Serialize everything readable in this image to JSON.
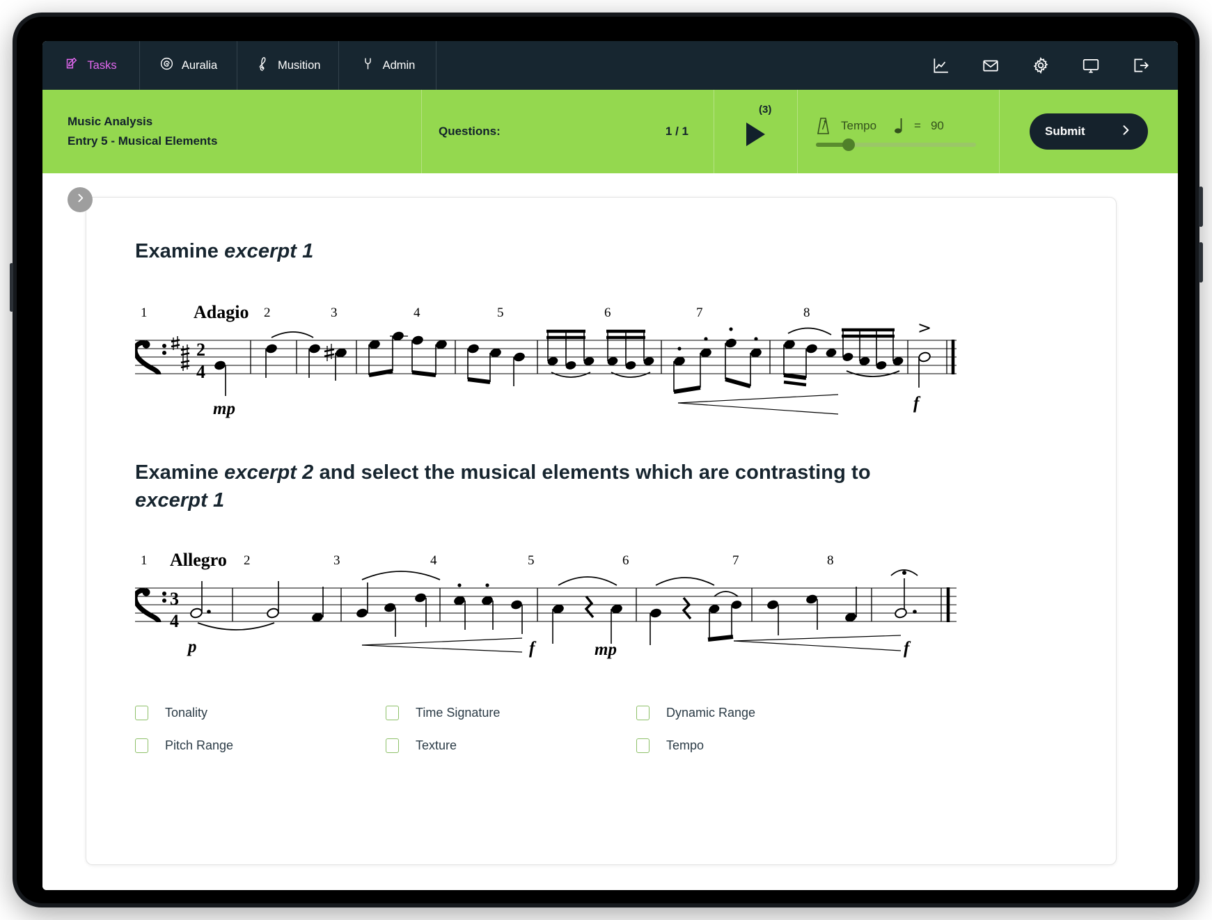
{
  "nav": {
    "tabs": [
      {
        "label": "Tasks",
        "icon": "pencil-square-icon",
        "active": true
      },
      {
        "label": "Auralia",
        "icon": "spiral-ear-icon",
        "active": false
      },
      {
        "label": "Musition",
        "icon": "treble-clef-icon",
        "active": false
      },
      {
        "label": "Admin",
        "icon": "wrench-icon",
        "active": false
      }
    ],
    "icons": [
      {
        "name": "chart-icon"
      },
      {
        "name": "mail-icon"
      },
      {
        "name": "gear-icon"
      },
      {
        "name": "monitor-icon"
      },
      {
        "name": "logout-icon"
      }
    ],
    "active_color": "#e368f0",
    "background": "#172630"
  },
  "toolbar": {
    "title_line1": "Music Analysis",
    "title_line2": "Entry 5 - Musical Elements",
    "questions_label": "Questions:",
    "questions_value": "1 / 1",
    "play_count": "(3)",
    "play_icon": "play-icon",
    "metronome_icon": "metronome-icon",
    "tempo_label": "Tempo",
    "tempo_note_icon": "quarter-note-icon",
    "tempo_equals": "=",
    "tempo_value": "90",
    "submit_label": "Submit",
    "submit_icon": "chevron-right-icon",
    "background": "#94d84f",
    "submit_background": "#15222c"
  },
  "content": {
    "collapse_icon": "chevron-right-icon",
    "question1": {
      "prefix": "Examine ",
      "emphasis": "excerpt 1",
      "suffix": ""
    },
    "question2": {
      "prefix": "Examine ",
      "emphasis": "excerpt 2",
      "middle": " and select the musical elements which are contrasting to ",
      "emphasis2": "excerpt 1"
    },
    "options": [
      {
        "label": "Tonality",
        "checked": false
      },
      {
        "label": "Time Signature",
        "checked": false
      },
      {
        "label": "Dynamic Range",
        "checked": false
      },
      {
        "label": "Pitch Range",
        "checked": false
      },
      {
        "label": "Texture",
        "checked": false
      },
      {
        "label": "Tempo",
        "checked": false
      }
    ],
    "checkbox_border_color": "#8dc068"
  },
  "scores": {
    "excerpt1": {
      "clef": "bass",
      "key_signature": "3 sharps",
      "time_signature": "2/4",
      "tempo_text": "Adagio",
      "measure_numbers": [
        "1",
        "2",
        "3",
        "4",
        "5",
        "6",
        "7",
        "8"
      ],
      "dynamics": [
        "mp",
        "f"
      ],
      "articulations": [
        "slur",
        "staccato",
        "accent",
        "crescendo hairpin"
      ],
      "final_barline": "double"
    },
    "excerpt2": {
      "clef": "bass",
      "key_signature": "none",
      "time_signature": "3/4",
      "tempo_text": "Allegro",
      "measure_numbers": [
        "1",
        "2",
        "3",
        "4",
        "5",
        "6",
        "7",
        "8"
      ],
      "dynamics": [
        "p",
        "f",
        "mp",
        "f"
      ],
      "articulations": [
        "tie",
        "slur",
        "staccato",
        "fermata",
        "crescendo hairpin",
        "rest"
      ],
      "final_barline": "double"
    }
  }
}
